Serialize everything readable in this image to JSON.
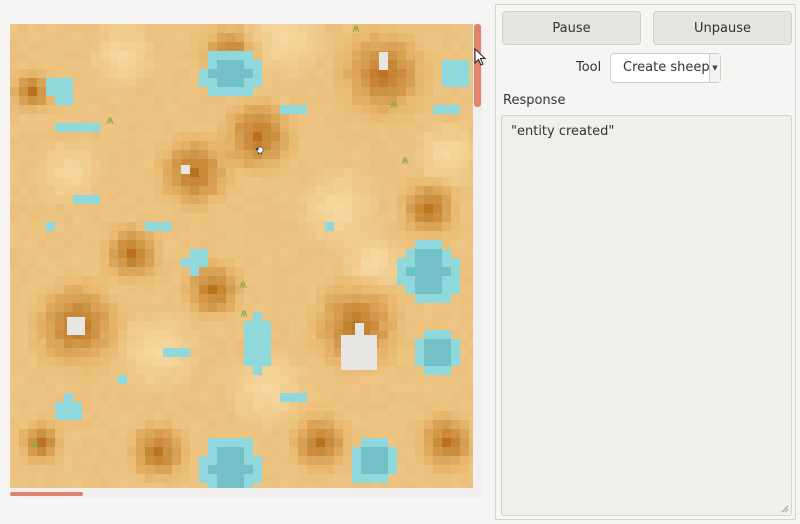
{
  "controls": {
    "pause_label": "Pause",
    "unpause_label": "Unpause",
    "tool_label": "Tool",
    "tool_selected": "Create sheep",
    "response_label": "Response",
    "response_text": "\"entity created\""
  },
  "map": {
    "cell_size": 9,
    "colors": {
      "water": "#8fd9dc",
      "water_deep": "#72c1c7",
      "rock": "#e8e6e3",
      "grass": "#91a940",
      "sand_light": "#f5d9a0",
      "sand_mid": "#e8b870",
      "sand_dark": "#b8711c"
    },
    "icons": [
      "sheep-icon",
      "grass-tuft-icon",
      "mouse-pointer-icon",
      "resize-grip-icon"
    ]
  },
  "colors": {
    "scrollbar_thumb": "#e0836b",
    "panel_bg": "#f6f5f4",
    "button_bg": "#e6e4e1"
  }
}
